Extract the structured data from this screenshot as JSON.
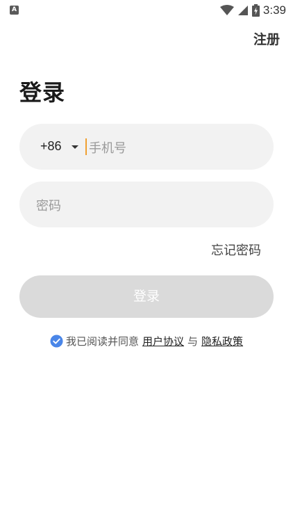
{
  "status_bar": {
    "app_indicator": "A",
    "time": "3:39"
  },
  "header": {
    "register_label": "注册"
  },
  "main": {
    "title": "登录",
    "phone": {
      "country_code": "+86",
      "placeholder": "手机号",
      "value": ""
    },
    "password": {
      "placeholder": "密码",
      "value": ""
    },
    "forgot_password_label": "忘记密码",
    "login_button_label": "登录"
  },
  "agreement": {
    "checked": true,
    "prefix": "我已阅读并同意",
    "user_agreement_label": "用户协议",
    "connector": "与",
    "privacy_policy_label": "隐私政策"
  },
  "colors": {
    "check_blue": "#4a86e8",
    "caret_orange": "#f0a030",
    "field_bg": "#f2f2f2",
    "button_disabled_bg": "#dadada"
  }
}
